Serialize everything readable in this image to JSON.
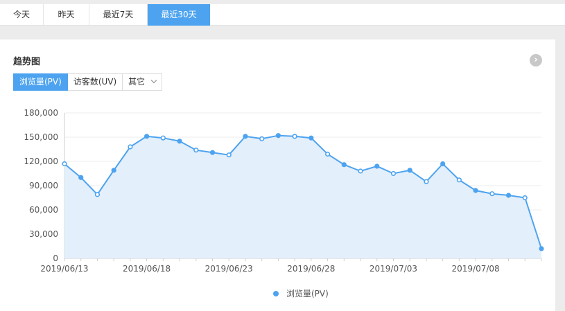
{
  "range_tabs": [
    {
      "label": "今天",
      "active": false
    },
    {
      "label": "昨天",
      "active": false
    },
    {
      "label": "最近7天",
      "active": false
    },
    {
      "label": "最近30天",
      "active": true
    }
  ],
  "panel": {
    "title": "趋势图",
    "more_icon": "chevron-right-circle-icon",
    "metric_buttons": [
      {
        "label": "浏览量(PV)",
        "active": true
      },
      {
        "label": "访客数(UV)",
        "active": false
      }
    ],
    "other_dropdown": {
      "label": "其它",
      "icon": "chevron-down-icon"
    }
  },
  "chart_data": {
    "type": "area",
    "x": [
      "2019/06/13",
      "2019/06/14",
      "2019/06/15",
      "2019/06/16",
      "2019/06/17",
      "2019/06/18",
      "2019/06/19",
      "2019/06/20",
      "2019/06/21",
      "2019/06/22",
      "2019/06/23",
      "2019/06/24",
      "2019/06/25",
      "2019/06/26",
      "2019/06/27",
      "2019/06/28",
      "2019/06/29",
      "2019/06/30",
      "2019/07/01",
      "2019/07/02",
      "2019/07/03",
      "2019/07/04",
      "2019/07/05",
      "2019/07/06",
      "2019/07/07",
      "2019/07/08",
      "2019/07/09",
      "2019/07/10",
      "2019/07/11",
      "2019/07/12"
    ],
    "x_tick_labels": [
      "2019/06/13",
      "2019/06/18",
      "2019/06/23",
      "2019/06/28",
      "2019/07/03",
      "2019/07/08"
    ],
    "series": [
      {
        "name": "浏览量(PV)",
        "color": "#4da3ef",
        "fill": "#e3effb",
        "values": [
          117000,
          100000,
          79000,
          109000,
          138000,
          151000,
          149000,
          145000,
          134000,
          131000,
          128000,
          151000,
          148000,
          152000,
          151000,
          149000,
          129000,
          116000,
          108000,
          114000,
          105000,
          109000,
          95000,
          117000,
          97000,
          84000,
          80000,
          78000,
          75000,
          12000
        ]
      }
    ],
    "y_ticks": [
      "0",
      "30,000",
      "60,000",
      "90,000",
      "120,000",
      "150,000",
      "180,000"
    ],
    "ylim": [
      0,
      180000
    ],
    "grid": true,
    "legend": "bottom-center"
  }
}
